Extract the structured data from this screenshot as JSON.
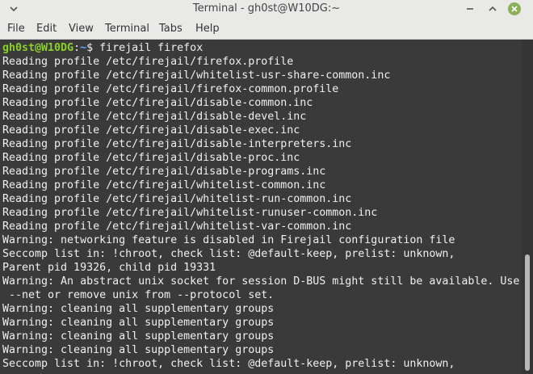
{
  "window": {
    "title": "Terminal - gh0st@W10DG:~"
  },
  "menubar": {
    "items": [
      "File",
      "Edit",
      "View",
      "Terminal",
      "Tabs",
      "Help"
    ]
  },
  "prompt": {
    "user_host": "gh0st@W10DG",
    "separator": ":",
    "path": "~",
    "symbol": "$ ",
    "command": "firejail firefox"
  },
  "output_lines": [
    "Reading profile /etc/firejail/firefox.profile",
    "Reading profile /etc/firejail/whitelist-usr-share-common.inc",
    "Reading profile /etc/firejail/firefox-common.profile",
    "Reading profile /etc/firejail/disable-common.inc",
    "Reading profile /etc/firejail/disable-devel.inc",
    "Reading profile /etc/firejail/disable-exec.inc",
    "Reading profile /etc/firejail/disable-interpreters.inc",
    "Reading profile /etc/firejail/disable-proc.inc",
    "Reading profile /etc/firejail/disable-programs.inc",
    "Reading profile /etc/firejail/whitelist-common.inc",
    "Reading profile /etc/firejail/whitelist-run-common.inc",
    "Reading profile /etc/firejail/whitelist-runuser-common.inc",
    "Reading profile /etc/firejail/whitelist-var-common.inc",
    "Warning: networking feature is disabled in Firejail configuration file",
    "Seccomp list in: !chroot, check list: @default-keep, prelist: unknown,",
    "Parent pid 19326, child pid 19331",
    "Warning: An abstract unix socket for session D-BUS might still be available. Use",
    " --net or remove unix from --protocol set.",
    "Warning: cleaning all supplementary groups",
    "Warning: cleaning all supplementary groups",
    "Warning: cleaning all supplementary groups",
    "Warning: cleaning all supplementary groups",
    "Seccomp list in: !chroot, check list: @default-keep, prelist: unknown,"
  ],
  "colors": {
    "terminal_bg": "#3a3a3a",
    "terminal_fg": "#f0f0f0",
    "prompt_user": "#8bd02a",
    "prompt_path": "#5fa8ff",
    "close_button": "#8bb158"
  },
  "icons": {
    "title_menu": "chevron-down-icon",
    "minimize": "minimize-icon",
    "maximize": "maximize-icon",
    "close": "close-icon"
  }
}
